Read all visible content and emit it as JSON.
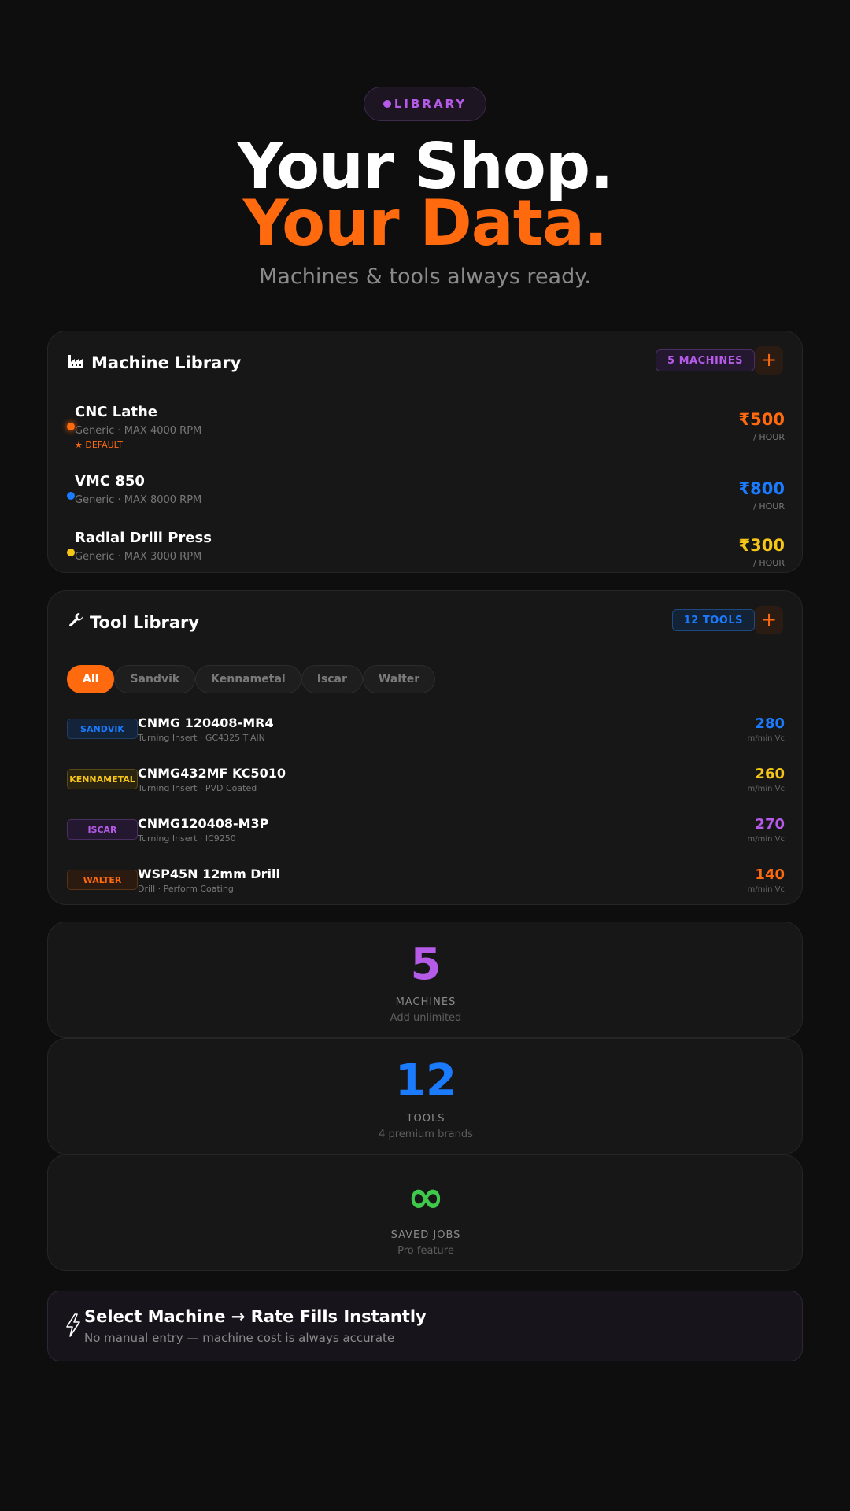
{
  "hero": {
    "pill": "LIBRARY",
    "line1": "Your Shop.",
    "line2": "Your Data.",
    "subtitle": "Machines & tools always ready."
  },
  "machine_library": {
    "icon": "factory-icon",
    "title": "Machine Library",
    "count_badge": "5 MACHINES",
    "add_label": "+",
    "machines": [
      {
        "name": "CNC Lathe",
        "sub": "Generic · MAX 4000 RPM",
        "default": "★ DEFAULT",
        "price": "₹500",
        "unit": "/ HOUR",
        "color": "#ff6a0f"
      },
      {
        "name": "VMC 850",
        "sub": "Generic · MAX 8000 RPM",
        "price": "₹800",
        "unit": "/ HOUR",
        "color": "#1a7bff"
      },
      {
        "name": "Radial Drill Press",
        "sub": "Generic · MAX 3000 RPM",
        "price": "₹300",
        "unit": "/ HOUR",
        "color": "#f5c518"
      }
    ]
  },
  "tool_library": {
    "icon": "wrench-icon",
    "title": "Tool Library",
    "count_badge": "12 TOOLS",
    "add_label": "+",
    "filters": [
      "All",
      "Sandvik",
      "Kennametal",
      "Iscar",
      "Walter"
    ],
    "active_filter": "All",
    "tools": [
      {
        "brand": "SANDVIK",
        "name": "CNMG 120408-MR4",
        "sub": "Turning Insert · GC4325 TiAlN",
        "value": "280",
        "unit": "m/min Vc",
        "color": "#1a7bff"
      },
      {
        "brand": "KENNAMETAL",
        "name": "CNMG432MF KC5010",
        "sub": "Turning Insert · PVD Coated",
        "value": "260",
        "unit": "m/min Vc",
        "color": "#f5c518"
      },
      {
        "brand": "ISCAR",
        "name": "CNMG120408-M3P",
        "sub": "Turning Insert · IC9250",
        "value": "270",
        "unit": "m/min Vc",
        "color": "#b65ae8"
      },
      {
        "brand": "WALTER",
        "name": "WSP45N 12mm Drill",
        "sub": "Drill · Perform Coating",
        "value": "140",
        "unit": "m/min Vc",
        "color": "#ff6a0f"
      }
    ]
  },
  "stats": [
    {
      "value": "5",
      "label": "MACHINES",
      "sub": "Add unlimited",
      "color": "#b65ae8"
    },
    {
      "value": "12",
      "label": "TOOLS",
      "sub": "4 premium brands",
      "color": "#1a7bff"
    },
    {
      "value": "∞",
      "label": "SAVED JOBS",
      "sub": "Pro feature",
      "color": "#3ec94a"
    }
  ],
  "callout": {
    "icon": "lightning-icon",
    "title": "Select Machine → Rate Fills Instantly",
    "subtitle": "No manual entry — machine cost is always accurate"
  }
}
